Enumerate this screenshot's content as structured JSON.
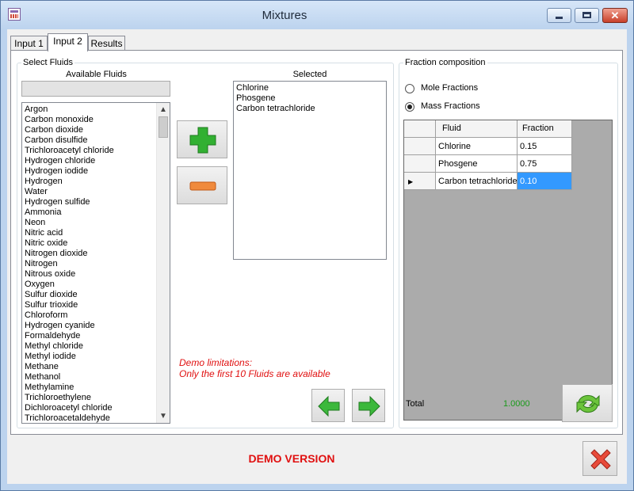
{
  "window": {
    "title": "Mixtures"
  },
  "tabs": [
    {
      "label": "Input 1"
    },
    {
      "label": "Input 2"
    },
    {
      "label": "Results"
    }
  ],
  "select_fluids": {
    "group_title": "Select Fluids",
    "available_label": "Available Fluids",
    "selected_label": "Selected",
    "available": [
      "Argon",
      "Carbon monoxide",
      "Carbon dioxide",
      "Carbon disulfide",
      "Trichloroacetyl chloride",
      "Hydrogen chloride",
      "Hydrogen iodide",
      "Hydrogen",
      "Water",
      "Hydrogen sulfide",
      "Ammonia",
      "Neon",
      "Nitric acid",
      "Nitric oxide",
      "Nitrogen dioxide",
      "Nitrogen",
      "Nitrous oxide",
      "Oxygen",
      "Sulfur dioxide",
      "Sulfur trioxide",
      "Chloroform",
      "Hydrogen cyanide",
      "Formaldehyde",
      "Methyl chloride",
      "Methyl iodide",
      "Methane",
      "Methanol",
      "Methylamine",
      "Trichloroethylene",
      "Dichloroacetyl chloride",
      "Trichloroacetaldehyde"
    ],
    "selected": [
      "Chlorine",
      "Phosgene",
      "Carbon tetrachloride"
    ],
    "demo_line1": "Demo limitations:",
    "demo_line2": "Only the first 10 Fluids are available"
  },
  "fraction": {
    "group_title": "Fraction composition",
    "mole_label": "Mole Fractions",
    "mass_label": "Mass Fractions",
    "selected_mode": "Mass Fractions",
    "columns": [
      "Fluid",
      "Fraction"
    ],
    "rows": [
      {
        "fluid": "Chlorine",
        "fraction": "0.15"
      },
      {
        "fluid": "Phosgene",
        "fraction": "0.75"
      },
      {
        "fluid": "Carbon tetrachloride",
        "fraction": "0.10"
      }
    ],
    "total_label": "Total",
    "total_value": "1.0000"
  },
  "footer": {
    "demo_version": "DEMO VERSION"
  },
  "colors": {
    "demo_red": "#e01010",
    "total_green": "#1a9a1a",
    "selection_blue": "#3399ff"
  },
  "icons": [
    "app-icon",
    "minimize-icon",
    "maximize-icon",
    "close-icon",
    "plus-icon",
    "minus-icon",
    "arrow-left-icon",
    "arrow-right-icon",
    "refresh-icon",
    "cancel-x-icon",
    "radio-mole-icon",
    "radio-mass-icon",
    "row-pointer-icon"
  ]
}
